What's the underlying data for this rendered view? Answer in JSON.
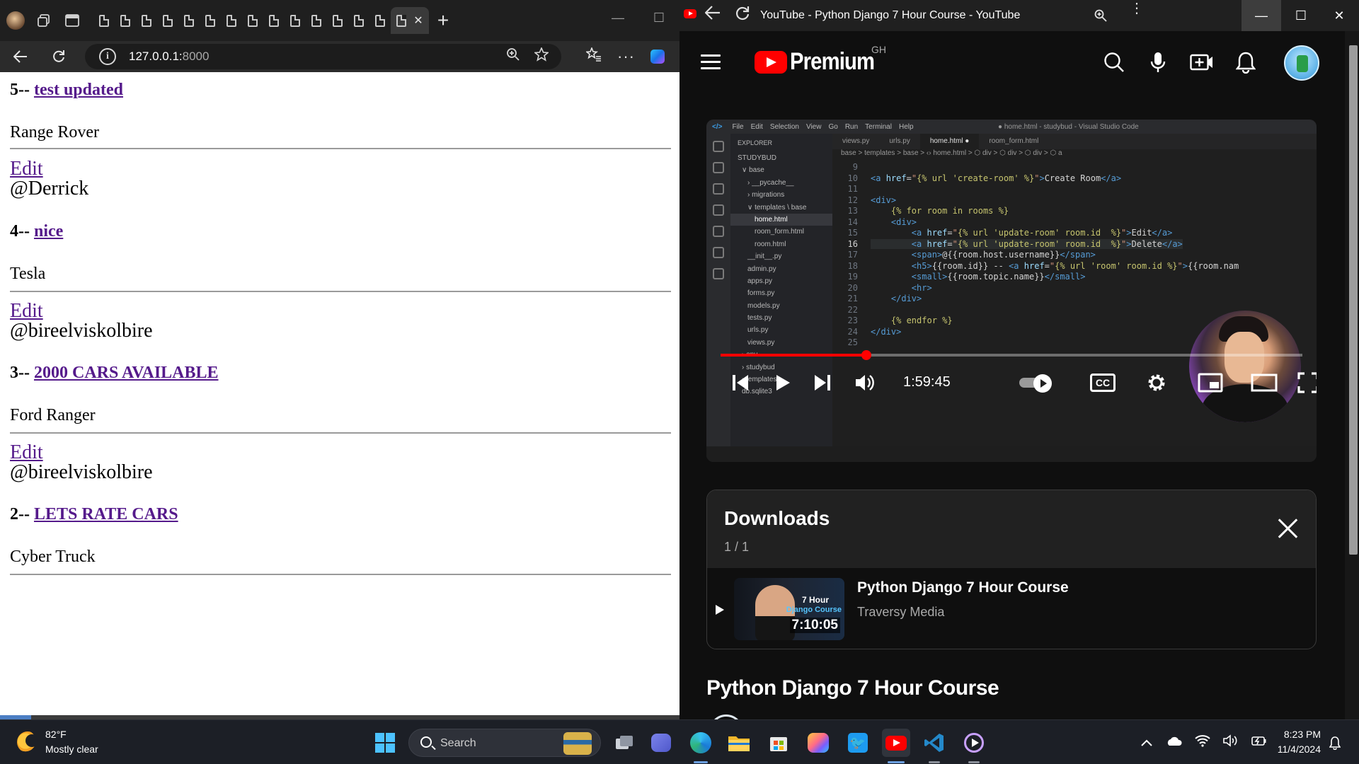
{
  "edge": {
    "url_host": "127.0.0.1:",
    "url_port": "8000",
    "rooms": [
      {
        "prefix": "5-- ",
        "name": "test updated",
        "topic": "Range Rover",
        "edit": "Edit",
        "host": "@Derrick"
      },
      {
        "prefix": "4-- ",
        "name": "nice",
        "topic": "Tesla",
        "edit": "Edit",
        "host": "@bireelviskolbire"
      },
      {
        "prefix": "3-- ",
        "name": "2000 CARS AVAILABLE",
        "topic": "Ford Ranger",
        "edit": "Edit",
        "host": "@bireelviskolbire"
      },
      {
        "prefix": "2-- ",
        "name": "LETS RATE CARS",
        "topic": "Cyber Truck",
        "edit": "",
        "host": ""
      }
    ]
  },
  "youtube": {
    "window_title": "YouTube - Python Django 7 Hour Course - YouTube",
    "brand": "Premium",
    "country": "GH",
    "player": {
      "time": "1:59:45",
      "progress_fraction": 0.25,
      "cc_label": "CC",
      "vscode": {
        "menu": [
          "File",
          "Edit",
          "Selection",
          "View",
          "Go",
          "Run",
          "Terminal",
          "Help"
        ],
        "window_title": "● home.html - studybud - Visual Studio Code",
        "tabs": [
          "views.py",
          "urls.py",
          "home.html ●",
          "room_form.html"
        ],
        "breadcrumb": "base > templates > base > ‹› home.html > ⬡ div > ⬡ div > ⬡ div > ⬡ a",
        "explorer": [
          "EXPLORER",
          "STUDYBUD",
          "∨ base",
          "› __pycache__",
          "› migrations",
          "∨ templates \\ base",
          "home.html",
          "room_form.html",
          "room.html",
          "__init__.py",
          "admin.py",
          "apps.py",
          "forms.py",
          "models.py",
          "tests.py",
          "urls.py",
          "views.py",
          "› env",
          "› studybud",
          "› templates",
          "db.sqlite3"
        ],
        "lines": [
          {
            "n": "9",
            "html": ""
          },
          {
            "n": "10",
            "html": "<span class='t-tag'>&lt;a</span> <span class='t-attr'>href</span>=<span class='t-str'>\"</span><span class='t-tpl'>{% url 'create-room' %}</span><span class='t-str'>\"</span><span class='t-tag'>&gt;</span>Create Room<span class='t-tag'>&lt;/a&gt;</span>"
          },
          {
            "n": "11",
            "html": ""
          },
          {
            "n": "12",
            "html": "<span class='t-tag'>&lt;div&gt;</span>"
          },
          {
            "n": "13",
            "html": "    <span class='t-tpl'>{% for room in rooms %}</span>"
          },
          {
            "n": "14",
            "html": "    <span class='t-tag'>&lt;div&gt;</span>"
          },
          {
            "n": "15",
            "html": "        <span class='t-tag'>&lt;a</span> <span class='t-attr'>href</span>=<span class='t-str'>\"</span><span class='t-tpl'>{% url 'update-room' room.id  %}</span><span class='t-str'>\"</span><span class='t-tag'>&gt;</span>Edit<span class='t-tag'>&lt;/a&gt;</span>"
          },
          {
            "n": "16",
            "html": "        <span class='t-tag'>&lt;a</span> <span class='t-attr'>href</span>=<span class='t-str'>\"</span><span class='t-tpl'>{% url 'update-room' room.id  %}</span><span class='t-str'>\"</span><span class='t-tag'>&gt;</span>Delete<span class='t-tag'>&lt;/a&gt;</span>"
          },
          {
            "n": "17",
            "html": "        <span class='t-tag'>&lt;span&gt;</span>@{{room.host.username}}<span class='t-tag'>&lt;/span&gt;</span>"
          },
          {
            "n": "18",
            "html": "        <span class='t-tag'>&lt;h5&gt;</span>{{room.id}} -- <span class='t-tag'>&lt;a</span> <span class='t-attr'>href</span>=<span class='t-str'>\"</span><span class='t-tpl'>{% url 'room' room.id %}</span><span class='t-str'>\"</span><span class='t-tag'>&gt;</span>{{room.nam"
          },
          {
            "n": "19",
            "html": "        <span class='t-tag'>&lt;small&gt;</span>{{room.topic.name}}<span class='t-tag'>&lt;/small&gt;</span>"
          },
          {
            "n": "20",
            "html": "        <span class='t-tag'>&lt;hr&gt;</span>"
          },
          {
            "n": "21",
            "html": "    <span class='t-tag'>&lt;/div&gt;</span>"
          },
          {
            "n": "22",
            "html": ""
          },
          {
            "n": "23",
            "html": "    <span class='t-tpl'>{% endfor %}</span>"
          },
          {
            "n": "24",
            "html": "<span class='t-tag'>&lt;/div&gt;</span>"
          },
          {
            "n": "25",
            "html": ""
          }
        ]
      }
    },
    "downloads": {
      "title": "Downloads",
      "count": "1 / 1",
      "items": [
        {
          "title": "Python Django 7 Hour Course",
          "channel": "Traversy Media",
          "thumb_line1": "7 Hour",
          "thumb_line2": "Django Course",
          "duration": "7:10:05"
        }
      ]
    },
    "video_title": "Python Django 7 Hour Course"
  },
  "taskbar": {
    "temperature": "82°F",
    "weather": "Mostly clear",
    "search_label": "Search",
    "time": "8:23 PM",
    "date": "11/4/2024"
  }
}
